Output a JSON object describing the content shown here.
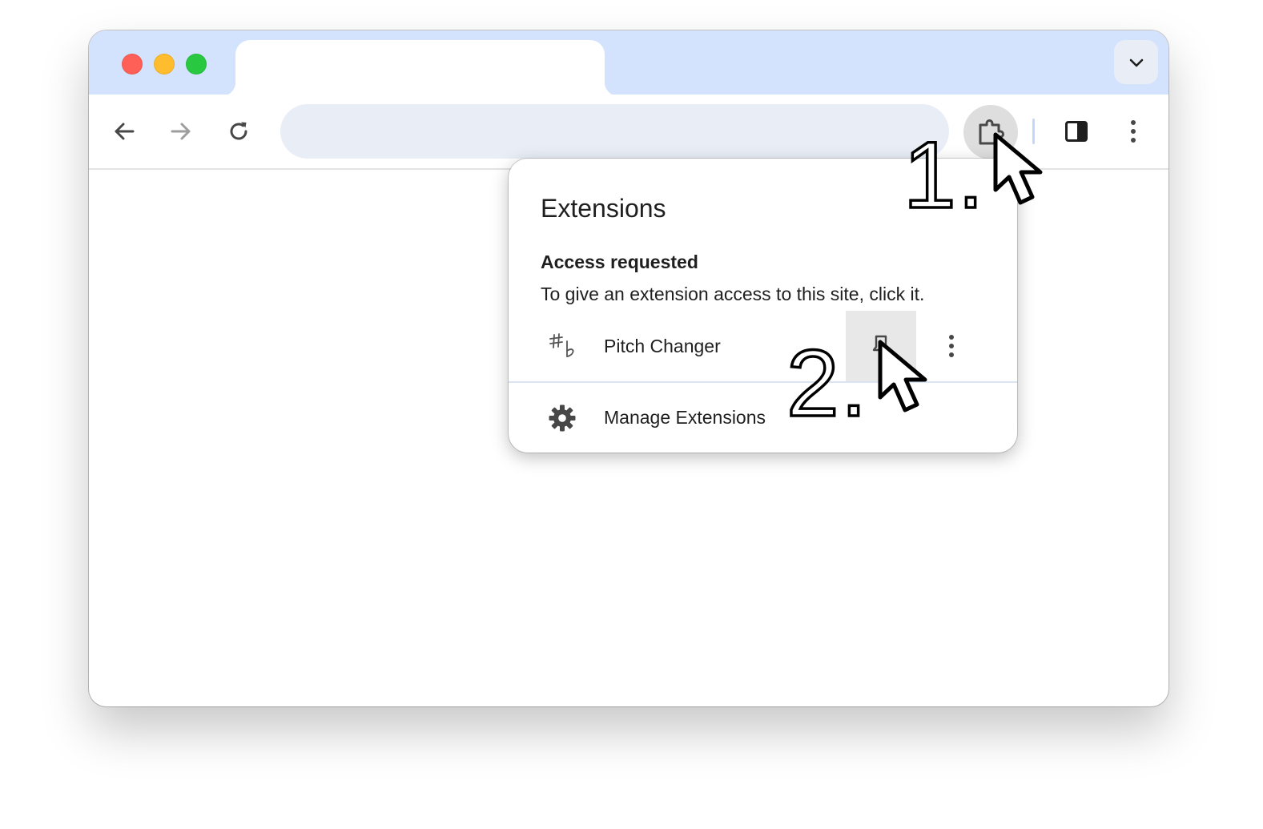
{
  "popup": {
    "title": "Extensions",
    "section_title": "Access requested",
    "section_description": "To give an extension access to this site, click it.",
    "extension": {
      "name": "Pitch Changer",
      "icon": "sharp-flat-icon"
    },
    "manage_label": "Manage Extensions"
  },
  "annotations": {
    "step_one": "1.",
    "step_two": "2."
  },
  "icons": {
    "back": "arrow-left-icon",
    "forward": "arrow-right-icon",
    "reload": "reload-icon",
    "extensions": "puzzle-piece-icon",
    "side_panel": "side-panel-icon",
    "menu": "three-dots-vertical-icon",
    "tab_search": "chevron-down-icon",
    "pin": "pin-icon",
    "manage": "gear-icon"
  },
  "colors": {
    "tab_strip": "#d3e3fd",
    "omnibox": "#e9eef6",
    "close": "#fe5f57",
    "minimize": "#febc2e",
    "zoom": "#28c840",
    "text": "#1f1f1f"
  }
}
